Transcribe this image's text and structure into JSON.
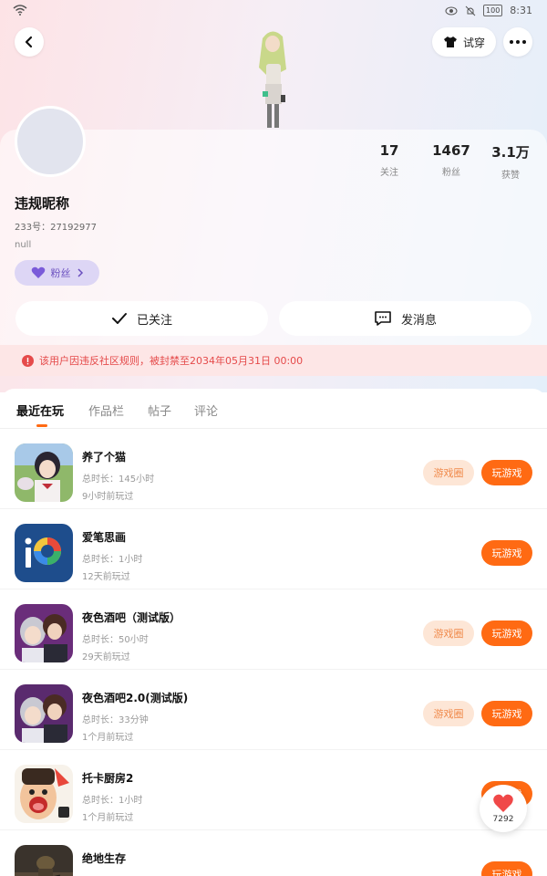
{
  "status_bar": {
    "time": "8:31",
    "battery": "100",
    "icons": [
      "wifi-icon",
      "eye-icon",
      "mute-bell-icon",
      "battery-icon"
    ]
  },
  "header": {
    "try_on_label": "试穿"
  },
  "profile": {
    "nickname": "违规昵称",
    "uid": "233号：27192977",
    "bio": "null",
    "fan_badge_label": "粉丝",
    "stats": [
      {
        "value": "17",
        "label": "关注"
      },
      {
        "value": "1467",
        "label": "粉丝"
      },
      {
        "value": "3.1万",
        "label": "获赞"
      }
    ],
    "follow_label": "已关注",
    "message_label": "发消息"
  },
  "ban_notice": "该用户因违反社区规则，被封禁至2034年05月31日 00:00",
  "tabs": [
    {
      "label": "最近在玩",
      "active": true
    },
    {
      "label": "作品栏",
      "active": false
    },
    {
      "label": "帖子",
      "active": false
    },
    {
      "label": "评论",
      "active": false
    }
  ],
  "games": [
    {
      "title": "养了个猫",
      "total_time": "总时长：145小时",
      "last_played": "9小时前玩过",
      "has_circle": true,
      "icon": "anime-girl-game-icon"
    },
    {
      "title": "爱笔思画",
      "total_time": "总时长：1小时",
      "last_played": "12天前玩过",
      "has_circle": false,
      "icon": "ibis-paint-icon"
    },
    {
      "title": "夜色酒吧（测试版）",
      "total_time": "总时长：50小时",
      "last_played": "29天前玩过",
      "has_circle": true,
      "icon": "night-bar-game-icon"
    },
    {
      "title": "夜色酒吧2.0(测试版)",
      "total_time": "总时长：33分钟",
      "last_played": "1个月前玩过",
      "has_circle": true,
      "icon": "night-bar-2-game-icon"
    },
    {
      "title": "托卡厨房2",
      "total_time": "总时长：1小时",
      "last_played": "1个月前玩过",
      "has_circle": false,
      "icon": "toca-kitchen-icon"
    },
    {
      "title": "绝地生存",
      "total_time": "",
      "last_played": "",
      "has_circle": false,
      "icon": "survival-game-icon"
    }
  ],
  "buttons": {
    "circle_label": "游戏圈",
    "play_label": "玩游戏"
  },
  "like_fab": {
    "count": "7292"
  },
  "colors": {
    "accent": "#ff6a13",
    "circle_bg": "#fde6d6",
    "ban_text": "#e54a4a",
    "badge_bg": "#ddd6f5"
  }
}
